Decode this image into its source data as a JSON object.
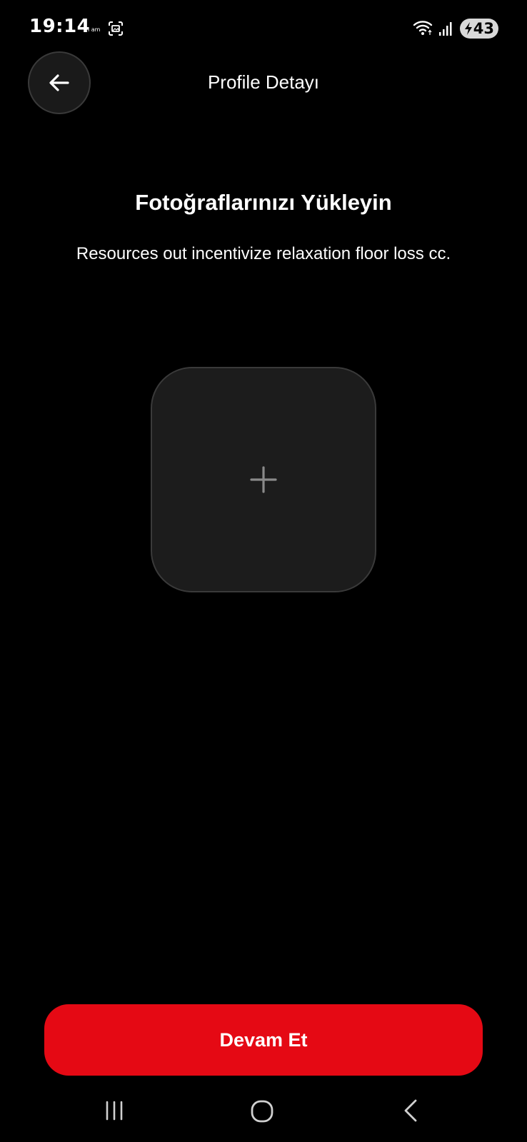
{
  "status_bar": {
    "time": "19:14",
    "carrier": "i am",
    "battery_level": "43",
    "icons": [
      "screenshot-icon",
      "wifi-icon",
      "signal-icon",
      "battery-charging-icon"
    ]
  },
  "header": {
    "title": "Profile Detayı",
    "back_icon": "arrow-left-icon"
  },
  "main": {
    "heading": "Fotoğraflarınızı Yükleyin",
    "subtitle": "Resources out incentivize relaxation floor loss cc.",
    "upload_tile_icon": "plus-icon"
  },
  "footer": {
    "continue_label": "Devam Et"
  },
  "nav_bar": {
    "icons": [
      "recents-icon",
      "home-icon",
      "back-icon"
    ]
  },
  "colors": {
    "background": "#000000",
    "accent": "#e50914",
    "tile_background": "#1c1c1c",
    "tile_border": "#3a3a3a",
    "plus_icon": "#8a8a8a"
  }
}
